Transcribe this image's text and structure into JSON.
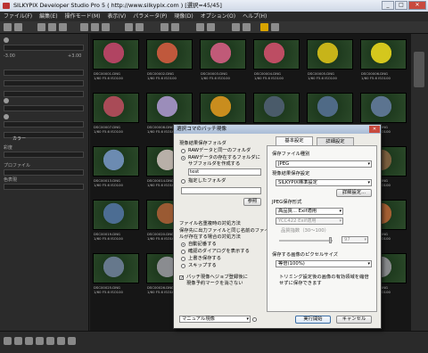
{
  "window": {
    "title": "SILKYPIX Developer Studio Pro 5 ( http://www.silkypix.com )  [選択=45/45]",
    "minimize": "_",
    "maximize": "□",
    "close": "✕"
  },
  "menu": [
    "ファイル(F)",
    "編集(E)",
    "操作モード(M)",
    "表示(V)",
    "パラメータ(P)",
    "現像(D)",
    "オプション(O)",
    "ヘルプ(H)"
  ],
  "sidebar": {
    "val_min": "-3.00",
    "val_max": "+3.00",
    "section_color": "カラー",
    "label_saturation": "彩度",
    "label_profile": "プロファイル",
    "label_colorspace": "色表現"
  },
  "colors": {
    "accent": "#ffd200",
    "titlebar": "#cfd8e6",
    "app_bg": "#222222"
  },
  "thumbnails": [
    {
      "name": "DSC00001.DNG",
      "line2": "1/60 F5.6 ISO100",
      "color": "#b14462"
    },
    {
      "name": "DSC00002.DNG",
      "line2": "1/60 F5.6 ISO100",
      "color": "#c0583c"
    },
    {
      "name": "DSC00003.DNG",
      "line2": "1/60 F5.6 ISO100",
      "color": "#c05a78"
    },
    {
      "name": "DSC00004.DNG",
      "line2": "1/60 F5.6 ISO100",
      "color": "#bd4d63"
    },
    {
      "name": "DSC00005.DNG",
      "line2": "1/60 F5.6 ISO100",
      "color": "#c7b419"
    },
    {
      "name": "DSC00006.DNG",
      "line2": "1/60 F5.6 ISO100",
      "color": "#d4c71d"
    },
    {
      "name": "DSC00007.DNG",
      "line2": "1/60 F5.6 ISO100",
      "color": "#a94b57"
    },
    {
      "name": "DSC00008.DNG",
      "line2": "1/60 F5.6 ISO100",
      "color": "#9b8dba"
    },
    {
      "name": "DSC00009.DNG",
      "line2": "1/60 F5.6 ISO100",
      "color": "#c98d1e"
    },
    {
      "name": "DSC00010.DNG",
      "line2": "1/60 F5.6 ISO100",
      "color": "#4a5b6a"
    },
    {
      "name": "DSC00011.DNG",
      "line2": "1/60 F5.6 ISO100",
      "color": "#4f6a86"
    },
    {
      "name": "DSC00012.DNG",
      "line2": "1/60 F5.6 ISO100",
      "color": "#5c7490"
    },
    {
      "name": "DSC00013.DNG",
      "line2": "1/60 F5.6 ISO100",
      "color": "#6c8bb1"
    },
    {
      "name": "DSC00014.DNG",
      "line2": "1/60 F5.6 ISO100",
      "color": "#b8b0a8"
    },
    {
      "name": "DSC00015.DNG",
      "line2": "1/60 F5.6 ISO100",
      "color": "#6e8a4c"
    },
    {
      "name": "DSC00016.DNG",
      "line2": "1/60 F5.6 ISO100",
      "color": "#3f6d9a"
    },
    {
      "name": "DSC00017.DNG",
      "line2": "1/60 F5.6 ISO100",
      "color": "#5f7b41"
    },
    {
      "name": "DSC00018.DNG",
      "line2": "1/60 F5.6 ISO100",
      "color": "#7a5e3e"
    },
    {
      "name": "DSC00019.DNG",
      "line2": "1/60 F5.6 ISO100",
      "color": "#4c6d93"
    },
    {
      "name": "DSC00020.DNG",
      "line2": "1/60 F5.6 ISO100",
      "color": "#9a5a33"
    },
    {
      "name": "DSC00021.DNG",
      "line2": "1/60 F5.6 ISO100",
      "color": "#2e3a4a"
    },
    {
      "name": "DSC00022.DNG",
      "line2": "1/60 F5.6 ISO100",
      "color": "#6c7d5a"
    },
    {
      "name": "DSC00023.DNG",
      "line2": "1/60 F5.6 ISO100",
      "color": "#8b6b4a"
    },
    {
      "name": "DSC00024.DNG",
      "line2": "1/60 F5.6 ISO100",
      "color": "#a45f33"
    },
    {
      "name": "DSC00025.DNG",
      "line2": "1/60 F5.6 ISO100",
      "color": "#66788c"
    },
    {
      "name": "DSC00026.DNG",
      "line2": "1/60 F5.6 ISO100",
      "color": "#8a8c90"
    },
    {
      "name": "DSC00027.DNG",
      "line2": "1/60 F5.6 ISO100",
      "color": "#aab4c0"
    },
    {
      "name": "DSC00028.DNG",
      "line2": "1/60 F5.6 ISO100",
      "color": "#b9793c"
    },
    {
      "name": "DSC00029.DNG",
      "line2": "1/60 F5.6 ISO100",
      "color": "#c96a2f"
    },
    {
      "name": "DSC00030.DNG",
      "line2": "1/60 F5.6 ISO100",
      "color": "#888a8c"
    }
  ],
  "dialog": {
    "title": "選択コマのバッチ現像",
    "close": "✕",
    "save_folder_label": "現像結果保存フォルダ",
    "opt_same_as_raw": "RAWデータと同一のフォルダ",
    "opt_subfolder": "RAWデータの存在するフォルダに",
    "opt_subfolder2": "サブフォルダを作成する",
    "subfolder_value": "test",
    "opt_specified": "指定したフォルダ",
    "browse": "参照",
    "naming_label": "ファイル名重複時の対処方法",
    "naming_desc1": "保存先に出力ファイルと同じ名前のファイ",
    "naming_desc2": "ルが存在する場合の対処方法",
    "opt_auto_rename": "自動記番する",
    "opt_confirm": "確認のダイアログを表示する",
    "opt_overwrite": "上書き保存する",
    "opt_skip": "スキップする",
    "chk_mark1": "バッチ現像へジョブ登録後に",
    "chk_mark2": "現像予約マークを消さない",
    "mode_select": "マニュアル現像",
    "tab_basic": "基本設定",
    "tab_advanced": "詳細設定",
    "filetype_label": "保存ファイル種別",
    "filetype_value": "JPEG",
    "jpeg_settings_label": "現像結果保存設定",
    "jpeg_settings_value": "SILKYPIX標準設定",
    "details_button": "詳細設定...",
    "jpeg_format_label": "JPEG保存形式",
    "quality_value": "高品質... Exif適用",
    "ycc_value": "YCC422 Exif適用",
    "quality_range": "品質指数（30～100）",
    "quality_num": "97",
    "pixel_size_label": "保存する画像のピクセルサイズ",
    "pixel_size_value": "等倍(100%)",
    "trimming_note1": "トリミング設定後の画像の有効領域を縮倍",
    "trimming_note2": "せずに保存できます",
    "run_button": "実行開始",
    "cancel_button": "キャンセル"
  }
}
